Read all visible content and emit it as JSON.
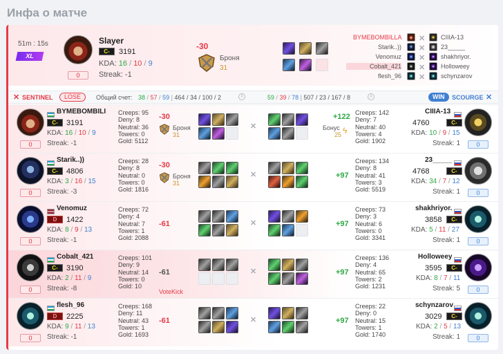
{
  "page_title": "Инфа о матче",
  "header": {
    "duration": "51m : 15s",
    "mode": "XL",
    "mvp_name": "Slayer",
    "mvp_rank": "C-",
    "mvp_rating": "3191",
    "kda_label": "KDA:",
    "kda_k": "16",
    "kda_sep1": "/",
    "kda_d": "10",
    "kda_sep2": "/",
    "kda_a": "9",
    "streak": "Streak: -1",
    "badge": "0",
    "delta": "-30",
    "armor_label": "Броня",
    "armor_value": "31",
    "sentinel_list": [
      "BYMEBOMBILLA",
      "Starik..))",
      "Venomuz",
      "Cobalt_421",
      "flesh_96"
    ],
    "scourge_list": [
      "CIIIA-13",
      "23_____",
      "shakhriyor.",
      "Holloweey",
      "schynzarov"
    ]
  },
  "scorebar": {
    "sentinel_label": "SENTINEL",
    "lose_label": "LOSE",
    "total_label": "Общий счет:",
    "s_kills": "38",
    "s_deaths": "57",
    "s_assists": "59",
    "s_rest": "464 / 34 / 100 / 2",
    "c_kills": "59",
    "c_deaths": "39",
    "c_assists": "78",
    "c_rest": "507 / 23 / 167 / 8",
    "win_label": "WIN",
    "scourge_label": "SCOURGE",
    "info_icon": "i"
  },
  "rows": [
    {
      "l_name": "BYMEBOMBILI",
      "l_rank": "C-",
      "l_rating": "3191",
      "l_k": "16",
      "l_d": "10",
      "l_a": "9",
      "l_streak": "Streak: -1",
      "l_badge": "0",
      "l_creeps": "Creeps: 95",
      "l_deny": "Deny: 8",
      "l_neutral": "Neutral: 36",
      "l_towers": "Towers: 0",
      "l_gold": "Gold: 5112",
      "l_delta": "-30",
      "l_armor": "Броня",
      "l_armor_v": "31",
      "l_note": "",
      "r_delta": "+122",
      "r_bonus": "Бонус",
      "r_bonus_v": "25",
      "r_creeps": "Creeps: 142",
      "r_deny": "Deny: 7",
      "r_neutral": "Neutral: 40",
      "r_towers": "Towers: 4",
      "r_gold": "Gold: 1902",
      "r_name": "CIIIA-13",
      "r_rank": "C-",
      "r_rating": "4760",
      "r_k": "10",
      "r_d": "9",
      "r_a": "15",
      "r_streak": "Streak: 1",
      "r_badge": "0"
    },
    {
      "l_name": "Starik..))",
      "l_rank": "C-",
      "l_rating": "4806",
      "l_k": "3",
      "l_d": "16",
      "l_a": "15",
      "l_streak": "Streak: -3",
      "l_badge": "0",
      "l_creeps": "Creeps: 28",
      "l_deny": "Deny: 8",
      "l_neutral": "Neutral: 0",
      "l_towers": "Towers: 0",
      "l_gold": "Gold: 1816",
      "l_delta": "-30",
      "l_armor": "Броня",
      "l_armor_v": "31",
      "l_note": "",
      "r_delta": "+97",
      "r_bonus": "",
      "r_bonus_v": "",
      "r_creeps": "Creeps: 134",
      "r_deny": "Deny: 8",
      "r_neutral": "Neutral: 41",
      "r_towers": "Towers: 3",
      "r_gold": "Gold: 5519",
      "r_name": "23_____",
      "r_rank": "C-",
      "r_rating": "4768",
      "r_k": "34",
      "r_d": "7",
      "r_a": "12",
      "r_streak": "Streak: 1",
      "r_badge": "0"
    },
    {
      "l_name": "Venomuz",
      "l_rank": "D",
      "l_rating": "1422",
      "l_k": "8",
      "l_d": "9",
      "l_a": "13",
      "l_streak": "Streak: -1",
      "l_badge": "0",
      "l_creeps": "Creeps: 72",
      "l_deny": "Deny: 4",
      "l_neutral": "Neutral: 7",
      "l_towers": "Towers: 1",
      "l_gold": "Gold: 2088",
      "l_delta": "-61",
      "l_armor": "",
      "l_armor_v": "",
      "l_note": "",
      "r_delta": "+97",
      "r_bonus": "",
      "r_bonus_v": "",
      "r_creeps": "Creeps: 73",
      "r_deny": "Deny: 3",
      "r_neutral": "Neutral: 6",
      "r_towers": "Towers: 0",
      "r_gold": "Gold: 3341",
      "r_name": "shakhriyor.",
      "r_rank": "C-",
      "r_rating": "3858",
      "r_k": "5",
      "r_d": "11",
      "r_a": "27",
      "r_streak": "Streak: 1",
      "r_badge": "0"
    },
    {
      "l_name": "Cobalt_421",
      "l_rank": "C-",
      "l_rating": "3190",
      "l_k": "2",
      "l_d": "11",
      "l_a": "9",
      "l_streak": "Streak: -8",
      "l_badge": "0",
      "l_creeps": "Creeps: 101",
      "l_deny": "Deny: 9",
      "l_neutral": "Neutral: 14",
      "l_towers": "Towers: 0",
      "l_gold": "Gold: 10",
      "l_delta": "-61",
      "l_armor": "",
      "l_armor_v": "",
      "l_note": "VoteKick",
      "r_delta": "+97",
      "r_bonus": "",
      "r_bonus_v": "",
      "r_creeps": "Creeps: 136",
      "r_deny": "Deny: 4",
      "r_neutral": "Neutral: 65",
      "r_towers": "Towers: 2",
      "r_gold": "Gold: 1231",
      "r_name": "Holloweey",
      "r_rank": "C-",
      "r_rating": "3595",
      "r_k": "8",
      "r_d": "7",
      "r_a": "11",
      "r_streak": "Streak: 5",
      "r_badge": "0"
    },
    {
      "l_name": "flesh_96",
      "l_rank": "D",
      "l_rating": "2225",
      "l_k": "9",
      "l_d": "11",
      "l_a": "13",
      "l_streak": "Streak: -1",
      "l_badge": "0",
      "l_creeps": "Creeps: 168",
      "l_deny": "Deny: 11",
      "l_neutral": "Neutral: 43",
      "l_towers": "Towers: 1",
      "l_gold": "Gold: 1693",
      "l_delta": "-61",
      "l_armor": "",
      "l_armor_v": "",
      "l_note": "",
      "r_delta": "+97",
      "r_bonus": "",
      "r_bonus_v": "",
      "r_creeps": "Creeps: 22",
      "r_deny": "Deny: 0",
      "r_neutral": "Neutral: 15",
      "r_towers": "Towers: 1",
      "r_gold": "Gold: 1740",
      "r_name": "schynzarov",
      "r_rank": "C-",
      "r_rating": "3029",
      "r_k": "2",
      "r_d": "5",
      "r_a": "13",
      "r_streak": "Streak: 1",
      "r_badge": "0"
    }
  ],
  "colors": {
    "accent_red": "#e53946",
    "accent_blue": "#3f7fd1",
    "kill_green": "#2ea843"
  }
}
